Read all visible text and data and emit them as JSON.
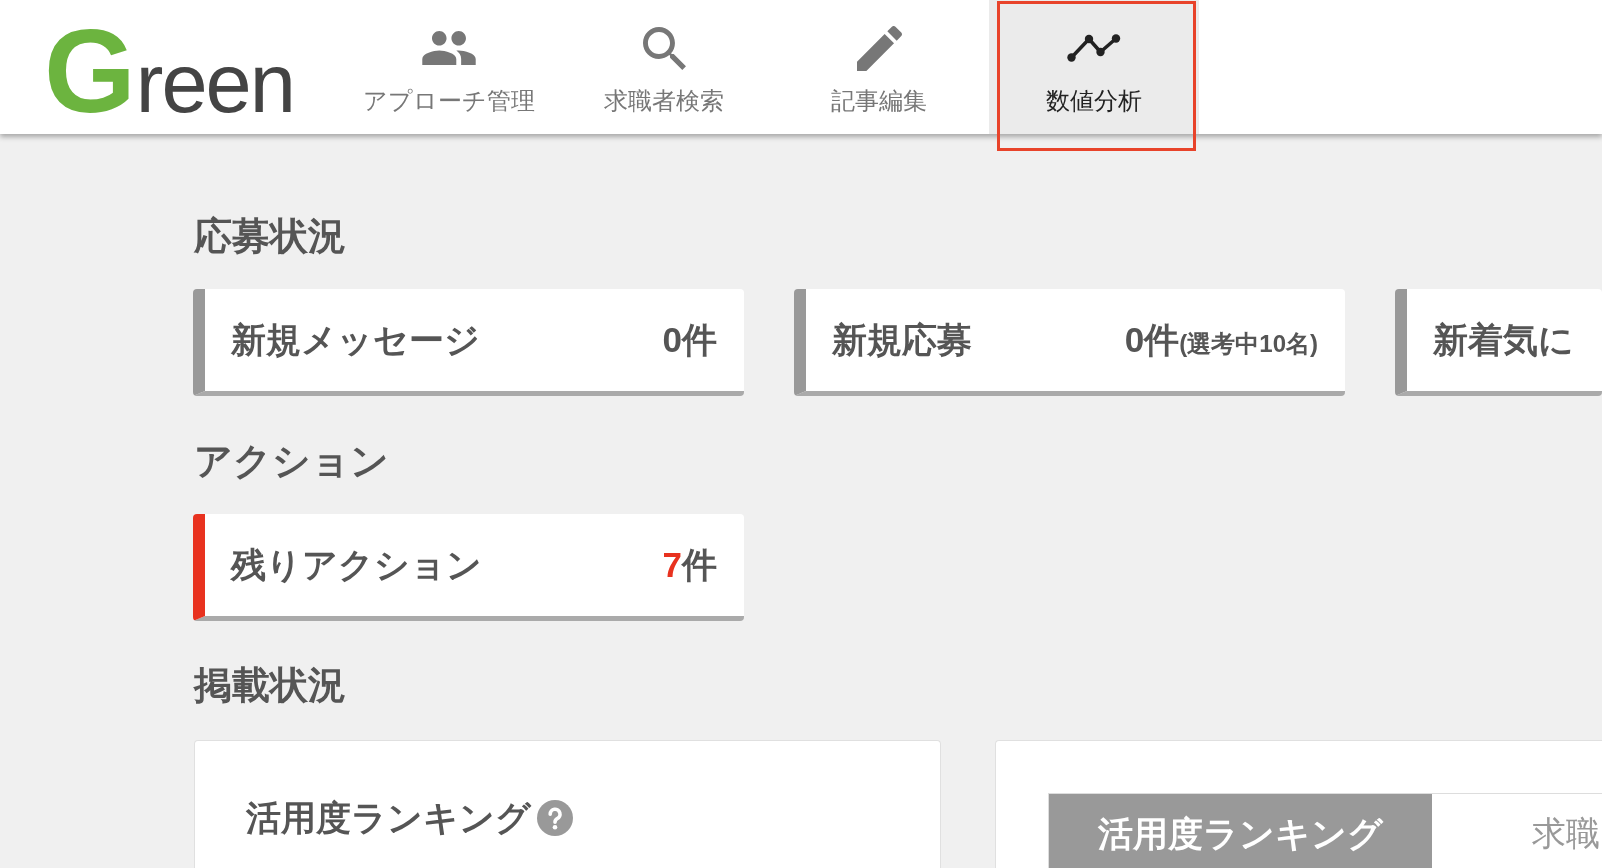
{
  "header": {
    "logo": "Green",
    "nav": [
      {
        "label": "アプローチ管理",
        "selected": false,
        "highlighted": false
      },
      {
        "label": "求職者検索",
        "selected": false,
        "highlighted": false
      },
      {
        "label": "記事編集",
        "selected": false,
        "highlighted": false
      },
      {
        "label": "数値分析",
        "selected": true,
        "highlighted": true
      }
    ]
  },
  "sections": [
    {
      "heading": "応募状況",
      "kind": "cards",
      "cards": [
        {
          "label": "新規メッセージ",
          "count": "0",
          "unit": "件",
          "alert": false
        },
        {
          "label": "新規応募",
          "count": "0",
          "unit": "件",
          "note": "(選考中10名)",
          "alert": false
        },
        {
          "label": "新着気に",
          "alert": false
        }
      ]
    },
    {
      "heading": "アクション",
      "kind": "cards",
      "cards": [
        {
          "label": "残りアクション",
          "count": "7",
          "unit": "件",
          "alert": true
        }
      ]
    },
    {
      "heading": "掲載状況",
      "kind": "panels",
      "panels": [
        {
          "kind": "title",
          "title": "活用度ランキング",
          "help": true
        },
        {
          "kind": "tabs",
          "tabs": [
            {
              "label": "活用度ランキング",
              "selected": true
            },
            {
              "label": "求職",
              "selected": false
            }
          ]
        }
      ]
    }
  ]
}
